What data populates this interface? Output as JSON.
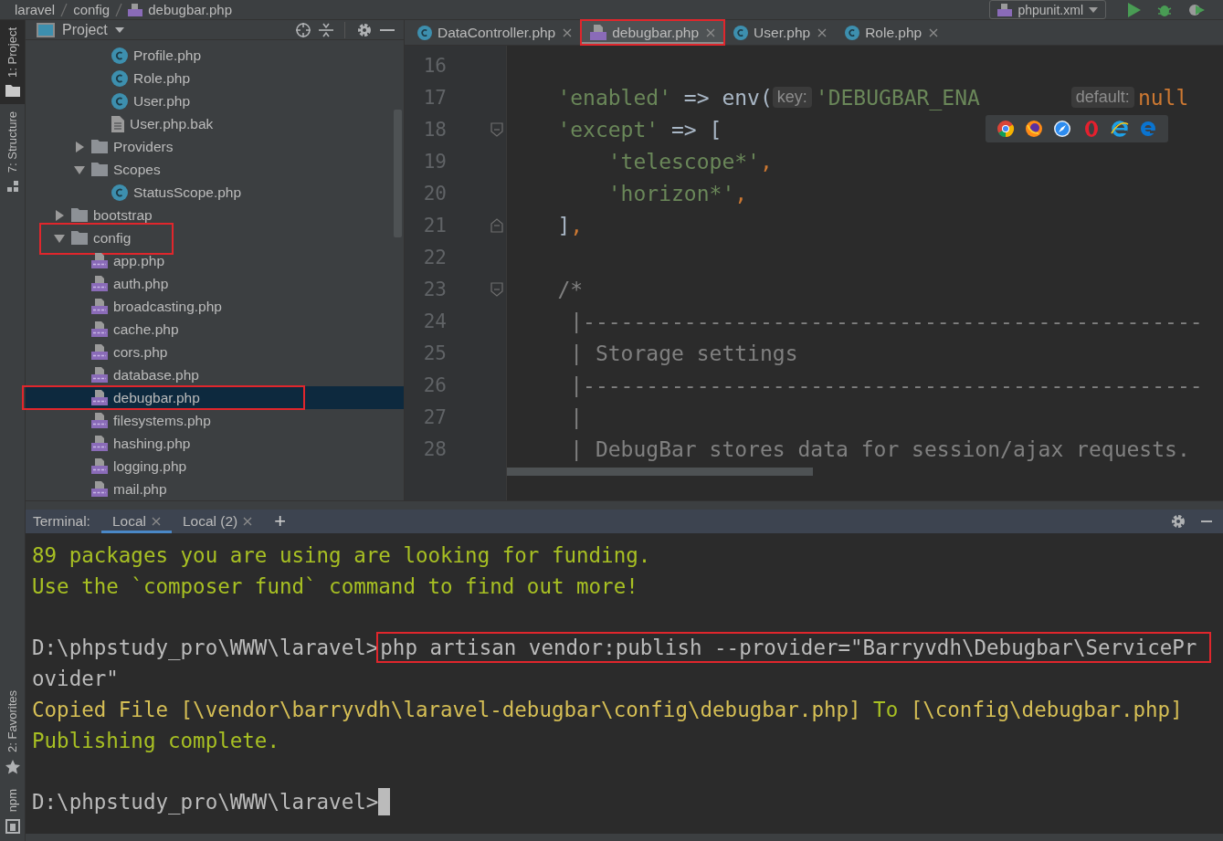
{
  "breadcrumb": [
    "laravel",
    "config",
    "debugbar.php"
  ],
  "run_config": "phpunit.xml",
  "tool_stripe": {
    "top": [
      {
        "label": "1: Project",
        "selected": true,
        "kind": "folder"
      },
      {
        "label": "7: Structure",
        "selected": false,
        "kind": "structure"
      }
    ],
    "bottom": [
      {
        "label": "2: Favorites",
        "selected": false,
        "kind": "star"
      },
      {
        "label": "npm",
        "selected": false,
        "kind": "npm"
      }
    ]
  },
  "project": {
    "title": "Project",
    "tree": [
      {
        "children": [
          {
            "children": [
              {
                "label": "Profile.php",
                "kind": "class",
                "selected": false,
                "highlighted": false
              },
              {
                "label": "Role.php",
                "kind": "class",
                "selected": false,
                "highlighted": false
              },
              {
                "label": "User.php",
                "kind": "class",
                "selected": false,
                "highlighted": false
              },
              {
                "label": "User.php.bak",
                "kind": "file",
                "selected": false,
                "highlighted": false
              }
            ]
          },
          {
            "label": "Providers",
            "kind": "folder",
            "expanded": false,
            "selected": false,
            "highlighted": false
          },
          {
            "label": "Scopes",
            "kind": "folder",
            "expanded": true,
            "selected": false,
            "highlighted": false,
            "children": [
              {
                "label": "StatusScope.php",
                "kind": "class",
                "selected": false,
                "highlighted": false
              }
            ]
          }
        ]
      },
      {
        "label": "bootstrap",
        "kind": "folder",
        "expanded": false,
        "selected": false,
        "highlighted": false
      },
      {
        "label": "config",
        "kind": "folder",
        "expanded": true,
        "selected": false,
        "highlighted": true,
        "children": [
          {
            "label": "app.php",
            "kind": "php",
            "selected": false,
            "highlighted": false
          },
          {
            "label": "auth.php",
            "kind": "php",
            "selected": false,
            "highlighted": false
          },
          {
            "label": "broadcasting.php",
            "kind": "php",
            "selected": false,
            "highlighted": false
          },
          {
            "label": "cache.php",
            "kind": "php",
            "selected": false,
            "highlighted": false
          },
          {
            "label": "cors.php",
            "kind": "php",
            "selected": false,
            "highlighted": false
          },
          {
            "label": "database.php",
            "kind": "php",
            "selected": false,
            "highlighted": false
          },
          {
            "label": "debugbar.php",
            "kind": "php",
            "selected": true,
            "highlighted": true
          },
          {
            "label": "filesystems.php",
            "kind": "php",
            "selected": false,
            "highlighted": false
          },
          {
            "label": "hashing.php",
            "kind": "php",
            "selected": false,
            "highlighted": false
          },
          {
            "label": "logging.php",
            "kind": "php",
            "selected": false,
            "highlighted": false
          },
          {
            "label": "mail.php",
            "kind": "php",
            "selected": false,
            "highlighted": false
          }
        ]
      }
    ]
  },
  "editor": {
    "tabs": [
      {
        "label": "DataController.php",
        "kind": "class",
        "selected": false,
        "highlighted": false
      },
      {
        "label": "debugbar.php",
        "kind": "php",
        "selected": true,
        "highlighted": true
      },
      {
        "label": "User.php",
        "kind": "class",
        "selected": false,
        "highlighted": false
      },
      {
        "label": "Role.php",
        "kind": "class",
        "selected": false,
        "highlighted": false
      }
    ],
    "lines": [
      {
        "number": "16",
        "kind": "plain"
      },
      {
        "number": "17",
        "kind": "plain",
        "tokens": [
          {
            "kind": "string",
            "text": "    'enabled'"
          },
          {
            "kind": "plain",
            "text": " => env("
          },
          {
            "kind": "hint",
            "text": "key:"
          },
          {
            "kind": "string",
            "text": "'DEBUGBAR_ENA"
          },
          {
            "kind": "hint",
            "text": "default:"
          },
          {
            "kind": "keyword",
            "text": "null"
          }
        ]
      },
      {
        "number": "18",
        "kind": "fold_start",
        "tokens": [
          {
            "kind": "string",
            "text": "    'except'"
          },
          {
            "kind": "plain",
            "text": " => ["
          }
        ]
      },
      {
        "number": "19",
        "kind": "plain",
        "tokens": [
          {
            "kind": "string",
            "text": "        'telescope*'"
          },
          {
            "kind": "punct",
            "text": ","
          }
        ]
      },
      {
        "number": "20",
        "kind": "plain",
        "tokens": [
          {
            "kind": "string",
            "text": "        'horizon*'"
          },
          {
            "kind": "punct",
            "text": ","
          }
        ]
      },
      {
        "number": "21",
        "kind": "fold_end",
        "tokens": [
          {
            "kind": "plain",
            "text": "    ]"
          },
          {
            "kind": "punct",
            "text": ","
          }
        ]
      },
      {
        "number": "22",
        "kind": "plain"
      },
      {
        "number": "23",
        "kind": "fold_start",
        "tokens": [
          {
            "kind": "comment",
            "text": "    /*"
          }
        ]
      },
      {
        "number": "24",
        "kind": "plain",
        "tokens": [
          {
            "kind": "comment",
            "text": "     |-------------------------------------------------"
          }
        ]
      },
      {
        "number": "25",
        "kind": "plain",
        "tokens": [
          {
            "kind": "comment",
            "text": "     | Storage settings"
          }
        ]
      },
      {
        "number": "26",
        "kind": "plain",
        "tokens": [
          {
            "kind": "comment",
            "text": "     |-------------------------------------------------"
          }
        ]
      },
      {
        "number": "27",
        "kind": "plain",
        "tokens": [
          {
            "kind": "comment",
            "text": "     |"
          }
        ]
      },
      {
        "number": "28",
        "kind": "plain",
        "tokens": [
          {
            "kind": "comment",
            "text": "     | DebugBar stores data for session/ajax requests."
          }
        ]
      }
    ]
  },
  "terminal": {
    "label": "Terminal:",
    "tabs": [
      {
        "label": "Local",
        "selected": true
      },
      {
        "label": "Local (2)",
        "selected": false
      }
    ],
    "add": "+",
    "lines": [
      {
        "segments": [
          {
            "kind": "info",
            "text": "89 packages you are using are looking for funding.",
            "highlighted": false
          }
        ]
      },
      {
        "segments": [
          {
            "kind": "info",
            "text": "Use the `composer fund` command to find out more!",
            "highlighted": false
          }
        ]
      },
      {
        "space_before": true,
        "segments": [
          {
            "kind": "plain",
            "text": "D:\\phpstudy_pro\\WWW\\laravel>",
            "highlighted": false
          },
          {
            "kind": "plain",
            "text": "php artisan vendor:publish --provider=\"Barryvdh\\Debugbar\\ServicePr",
            "highlighted": true
          }
        ]
      },
      {
        "segments": [
          {
            "kind": "plain",
            "text": "ovider\"",
            "highlighted": false
          }
        ]
      },
      {
        "segments": [
          {
            "kind": "path",
            "text": "Copied File [\\vendor\\barryvdh\\laravel-debugbar\\config\\debugbar.php]",
            "highlighted": false
          },
          {
            "kind": "info",
            "text": "To",
            "highlighted": false
          },
          {
            "kind": "path",
            "text": "[\\config\\debugbar.php]",
            "highlighted": false
          }
        ]
      },
      {
        "segments": [
          {
            "kind": "info",
            "text": "Publishing complete.",
            "highlighted": false
          }
        ]
      },
      {
        "space_before": true,
        "cursor": true,
        "segments": [
          {
            "kind": "plain",
            "text": "D:\\phpstudy_pro\\WWW\\laravel>",
            "highlighted": false
          }
        ]
      }
    ]
  }
}
